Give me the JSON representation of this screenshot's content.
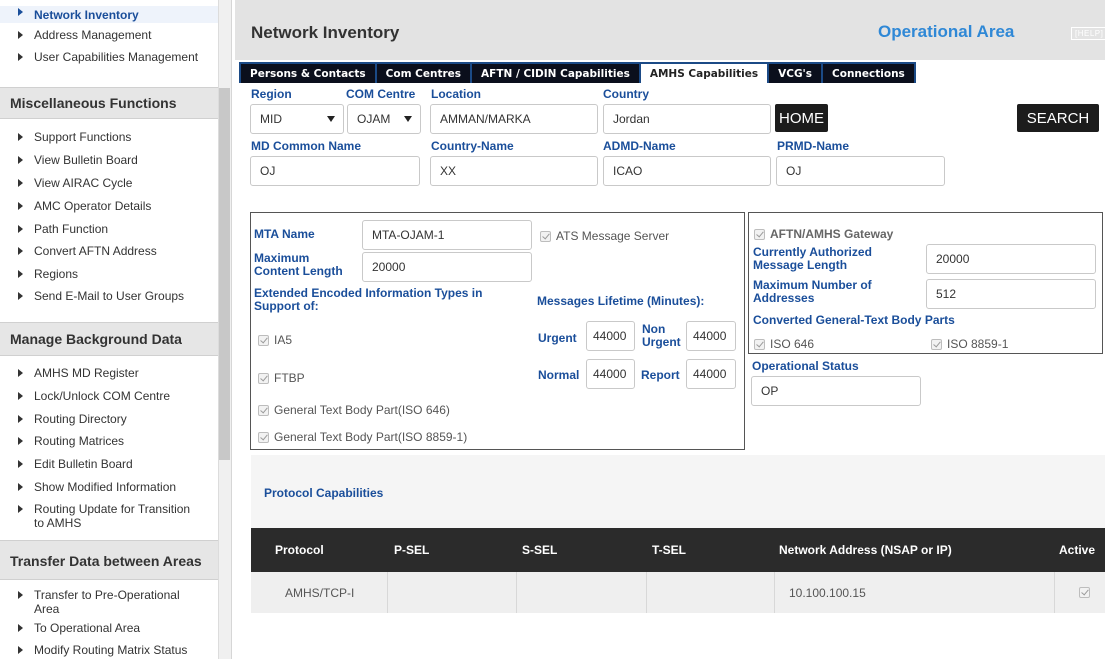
{
  "sidebar": {
    "top_items": [
      {
        "label": "Network Inventory",
        "active": true
      },
      {
        "label": "Address Management"
      },
      {
        "label": "User Capabilities Management"
      }
    ],
    "sections": [
      {
        "title": "Miscellaneous Functions",
        "items": [
          "Support Functions",
          "View Bulletin Board",
          "View AIRAC Cycle",
          "AMC Operator Details",
          "Path Function",
          "Convert AFTN Address",
          "Regions",
          "Send E-Mail to User Groups"
        ]
      },
      {
        "title": "Manage Background Data",
        "items": [
          "AMHS MD Register",
          "Lock/Unlock COM Centre",
          "Routing Directory",
          "Routing Matrices",
          "Edit Bulletin Board",
          "Show Modified Information",
          "Routing Update for Transition to AMHS"
        ]
      },
      {
        "title": "Transfer Data between Areas",
        "items": [
          "Transfer to Pre-Operational Area",
          "To Operational Area",
          "Modify Routing Matrix Status"
        ]
      }
    ]
  },
  "header": {
    "title": "Network Inventory",
    "area": "Operational Area",
    "help": "[HELP]"
  },
  "tabs": [
    {
      "label": "Persons & Contacts"
    },
    {
      "label": "Com Centres"
    },
    {
      "label": "AFTN / CIDIN Capabilities"
    },
    {
      "label": "AMHS Capabilities",
      "active": true
    },
    {
      "label": "VCG's"
    },
    {
      "label": "Connections"
    }
  ],
  "filters": {
    "region_label": "Region",
    "region_value": "MID",
    "com_centre_label": "COM Centre",
    "com_centre_value": "OJAM",
    "location_label": "Location",
    "location_value": "AMMAN/MARKA",
    "country_label": "Country",
    "country_value": "Jordan",
    "home_label": "HOME",
    "search_label": "SEARCH",
    "md_common_label": "MD Common Name",
    "md_common_value": "OJ",
    "country_name_label": "Country-Name",
    "country_name_value": "XX",
    "admd_label": "ADMD-Name",
    "admd_value": "ICAO",
    "prmd_label": "PRMD-Name",
    "prmd_value": "OJ"
  },
  "mta": {
    "mta_name_label": "MTA Name",
    "mta_name_value": "MTA-OJAM-1",
    "ats_server_label": "ATS Message Server",
    "max_content_label": "Maximum Content Length",
    "max_content_value": "20000",
    "eit_label": "Extended Encoded Information Types in Support of:",
    "lifetime_label": "Messages Lifetime (Minutes):",
    "eit_items": [
      "IA5",
      "FTBP",
      "General Text Body Part(ISO 646)",
      "General Text Body Part(ISO 8859-1)"
    ],
    "urgent_label": "Urgent",
    "urgent_value": "44000",
    "non_urgent_label": "Non Urgent",
    "non_urgent_value": "44000",
    "normal_label": "Normal",
    "normal_value": "44000",
    "report_label": "Report",
    "report_value": "44000"
  },
  "gateway": {
    "gateway_label": "AFTN/AMHS Gateway",
    "auth_len_label": "Currently Authorized Message Length",
    "auth_len_value": "20000",
    "max_addr_label": "Maximum Number of Addresses",
    "max_addr_value": "512",
    "converted_label": "Converted General-Text Body Parts",
    "iso646_label": "ISO 646",
    "iso8859_label": "ISO 8859-1",
    "op_status_label": "Operational Status",
    "op_status_value": "OP"
  },
  "protocol": {
    "title": "Protocol Capabilities",
    "headers": [
      "Protocol",
      "P-SEL",
      "S-SEL",
      "T-SEL",
      "Network Address (NSAP or IP)",
      "Active"
    ],
    "rows": [
      {
        "protocol": "AMHS/TCP-I",
        "psel": "",
        "ssel": "",
        "tsel": "",
        "address": "10.100.100.15"
      }
    ]
  },
  "colors": {
    "accent_blue": "#1a4e9a",
    "area_blue": "#2f88d6",
    "tab_bar": "#1b4a86",
    "dark": "#1c1c1c"
  }
}
